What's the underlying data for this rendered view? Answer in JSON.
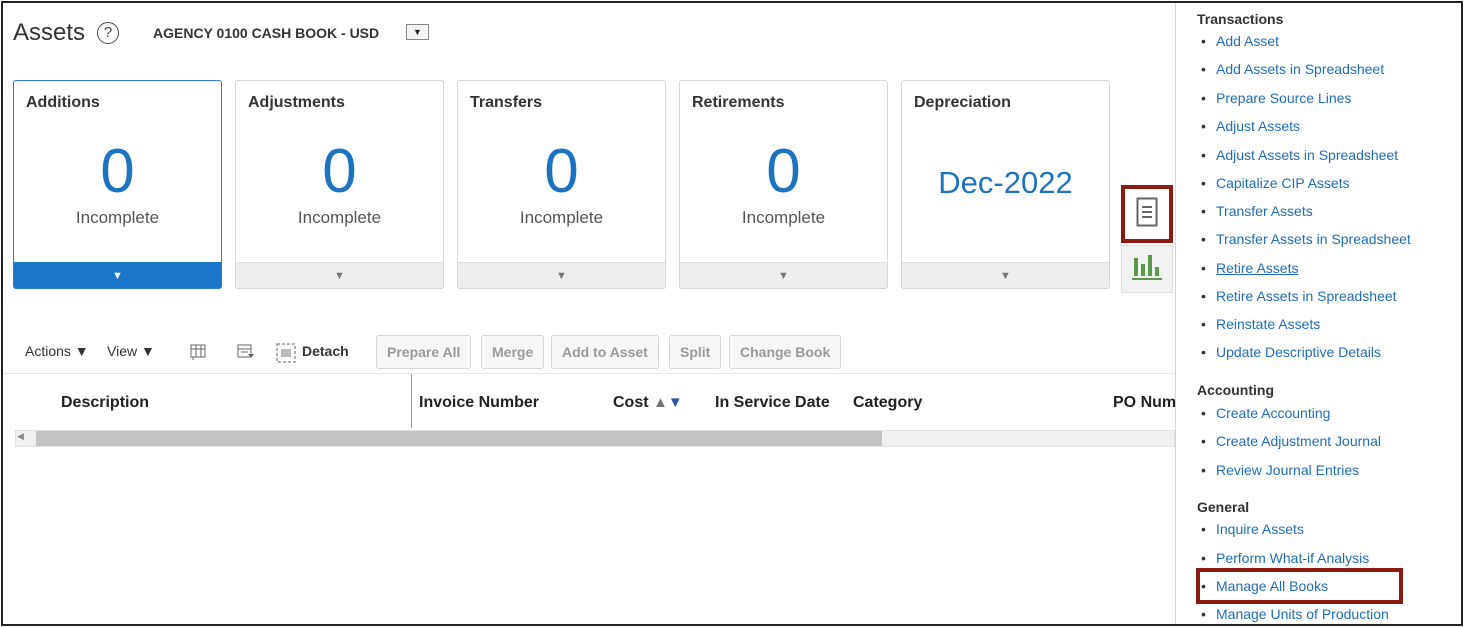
{
  "header": {
    "title": "Assets",
    "help_icon": "?",
    "book": "AGENCY 0100 CASH BOOK - USD",
    "book_dropdown": "▼"
  },
  "tiles": [
    {
      "title": "Additions",
      "value": "0",
      "sub": "Incomplete",
      "selected": true
    },
    {
      "title": "Adjustments",
      "value": "0",
      "sub": "Incomplete"
    },
    {
      "title": "Transfers",
      "value": "0",
      "sub": "Incomplete"
    },
    {
      "title": "Retirements",
      "value": "0",
      "sub": "Incomplete"
    },
    {
      "title": "Depreciation",
      "value": "Dec-2022"
    }
  ],
  "tile_arrow": "▼",
  "side_icons": {
    "list": "list-view-icon",
    "chart": "chart-view-icon"
  },
  "toolbar": {
    "actions": "Actions ▼",
    "view": "View ▼",
    "detach": "Detach",
    "buttons": [
      "Prepare All",
      "Merge",
      "Add to Asset",
      "Split",
      "Change Book"
    ]
  },
  "table": {
    "columns": [
      "Description",
      "Invoice Number",
      "Cost",
      "In Service Date",
      "Category",
      "PO Num"
    ],
    "sort_icons": "▲▼"
  },
  "panel": {
    "transactions": {
      "title": "Transactions",
      "links": [
        "Add Asset",
        "Add Assets in Spreadsheet",
        "Prepare Source Lines",
        "Adjust Assets",
        "Adjust Assets in Spreadsheet",
        "Capitalize CIP Assets",
        "Transfer Assets",
        "Transfer Assets in Spreadsheet",
        "Retire Assets",
        "Retire Assets in Spreadsheet",
        "Reinstate Assets",
        "Update Descriptive Details"
      ]
    },
    "accounting": {
      "title": "Accounting",
      "links": [
        "Create Accounting",
        "Create Adjustment Journal",
        "Review Journal Entries"
      ]
    },
    "general": {
      "title": "General",
      "links": [
        "Inquire Assets",
        "Perform What-if Analysis",
        "Manage All Books",
        "Manage Units of Production"
      ]
    }
  },
  "colors": {
    "accent": "#1b76c9",
    "highlight": "#8b1a12",
    "link": "#1f6db8"
  }
}
